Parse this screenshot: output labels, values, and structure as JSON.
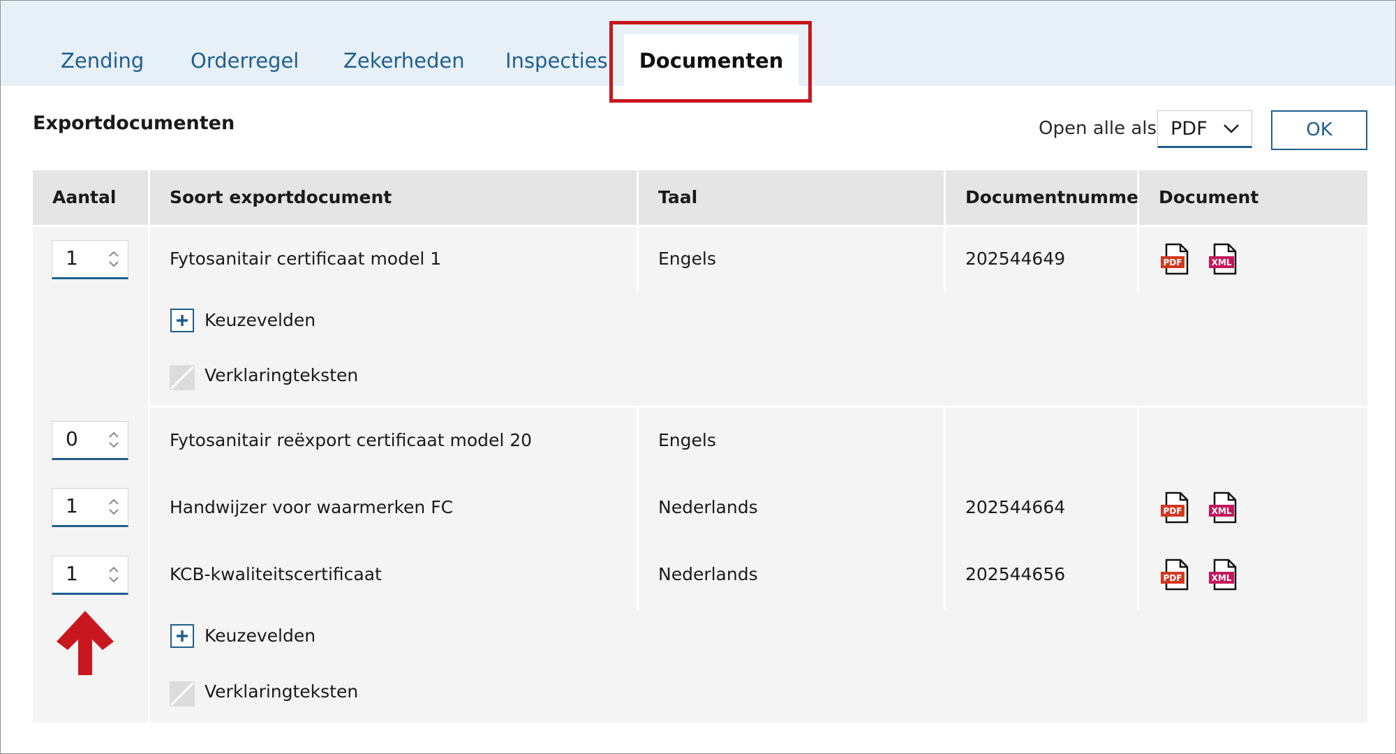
{
  "tabs": [
    {
      "label": "Zending",
      "active": false
    },
    {
      "label": "Orderregel",
      "active": false
    },
    {
      "label": "Zekerheden",
      "active": false
    },
    {
      "label": "Inspecties",
      "active": false
    },
    {
      "label": "Documenten",
      "active": true
    }
  ],
  "section": {
    "title": "Exportdocumenten",
    "open_all_label": "Open alle als",
    "format_select": {
      "value": "PDF"
    },
    "ok_label": "OK"
  },
  "table": {
    "headers": [
      "Aantal",
      "Soort exportdocument",
      "Taal",
      "Documentnummer",
      "Document"
    ],
    "rows": [
      {
        "quantity": "1",
        "type": "Fytosanitair certificaat model 1",
        "language": "Engels",
        "doc_number": "202544649",
        "pdf_label": "PDF",
        "xml_label": "XML"
      },
      {
        "quantity": "0",
        "type": "Fytosanitair reëxport certificaat model 20",
        "language": "Engels",
        "doc_number": "",
        "pdf_label": "",
        "xml_label": ""
      },
      {
        "quantity": "1",
        "type": "Handwijzer voor waarmerken FC",
        "language": "Nederlands",
        "doc_number": "202544664",
        "pdf_label": "PDF",
        "xml_label": "XML"
      },
      {
        "quantity": "1",
        "type": "KCB-kwaliteitscertificaat",
        "language": "Nederlands",
        "doc_number": "202544656",
        "pdf_label": "PDF",
        "xml_label": "XML"
      }
    ],
    "sub_options": {
      "choice_fields": "Keuzevelden",
      "declaration_texts": "Verklaringteksten"
    }
  },
  "colors": {
    "accent": "#1f5e8e",
    "highlight": "#c8171e",
    "pdf": "#d2381f",
    "xml": "#c2185b"
  }
}
